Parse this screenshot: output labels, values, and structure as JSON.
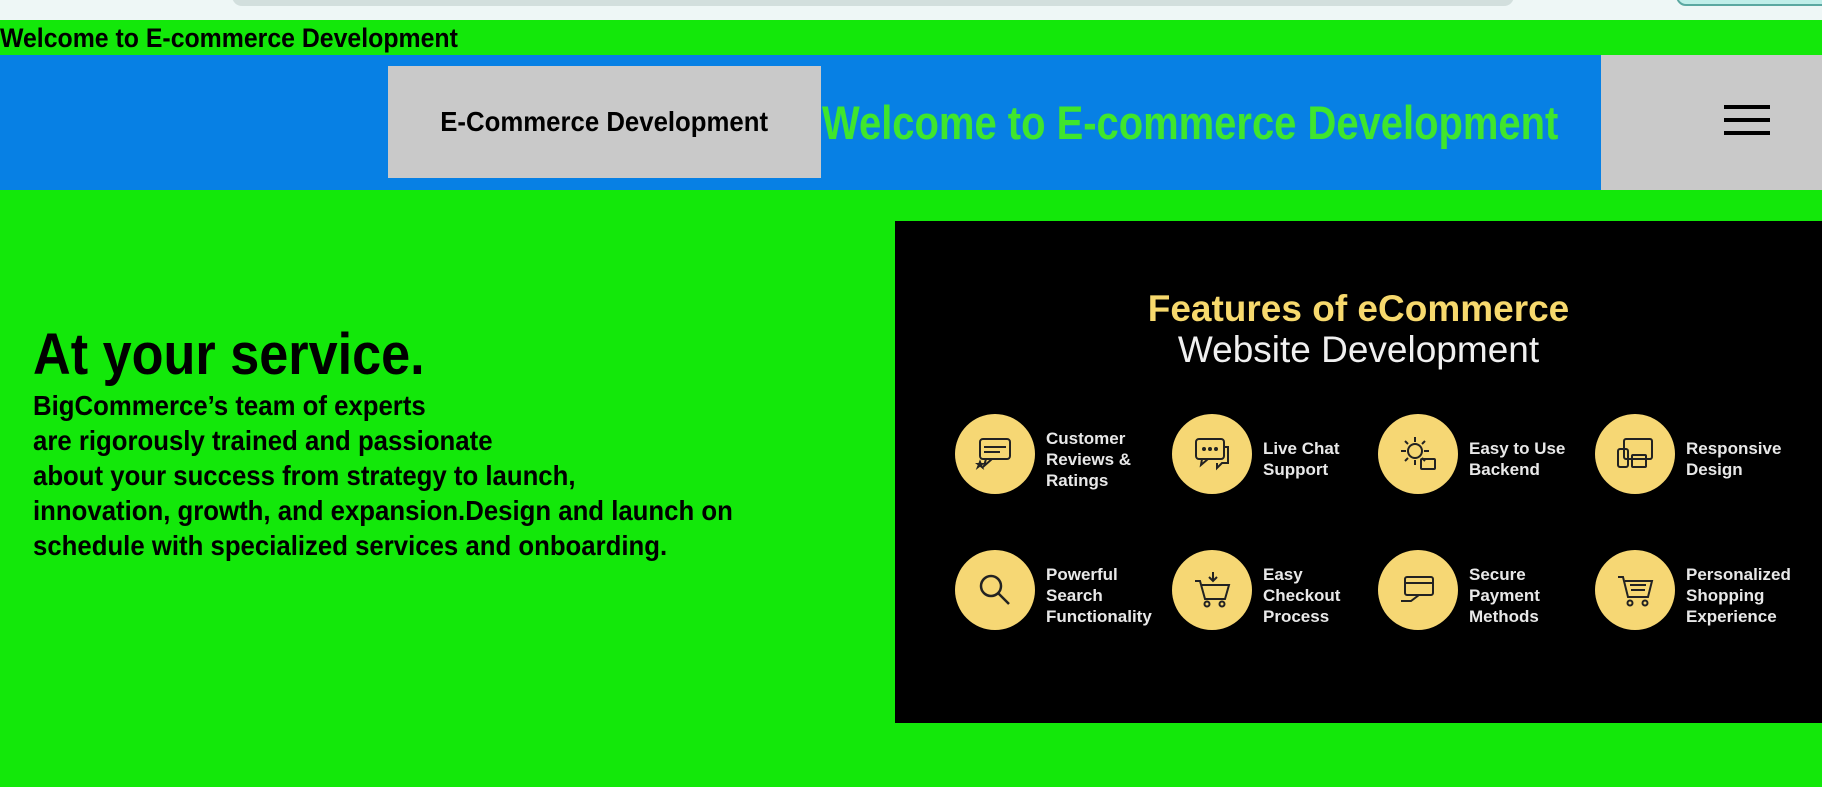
{
  "top_banner": {
    "text": "Welcome to E-commerce Development"
  },
  "navbar": {
    "brand": "E-Commerce Development",
    "welcome": "Welcome to E-commerce Development",
    "menu_icon": "hamburger-menu-icon"
  },
  "hero": {
    "title": "At your service.",
    "lines": [
      "BigCommerce’s team of experts",
      "are rigorously trained and passionate",
      "about your success from strategy to launch,",
      "innovation, growth, and expansion.Design and launch on",
      "schedule with specialized services and onboarding."
    ]
  },
  "feature_image": {
    "title_line1": "Features of eCommerce",
    "title_line2": "Website Development",
    "features": [
      {
        "label": "Customer\nReviews &\nRatings",
        "icon": "reviews-icon"
      },
      {
        "label": "Live Chat\nSupport",
        "icon": "chat-icon"
      },
      {
        "label": "Easy to Use\nBackend",
        "icon": "gear-icon"
      },
      {
        "label": "Responsive\nDesign",
        "icon": "devices-icon"
      },
      {
        "label": "Powerful\nSearch\nFunctionality",
        "icon": "search-icon"
      },
      {
        "label": "Easy\nCheckout\nProcess",
        "icon": "cart-icon"
      },
      {
        "label": "Secure\nPayment\nMethods",
        "icon": "card-icon"
      },
      {
        "label": "Personalized\nShopping\nExperience",
        "icon": "shopping-cart-icon"
      }
    ]
  },
  "colors": {
    "page_background": "#13e80a",
    "navbar_background": "#0780e4",
    "nav_box": "#c9c9c9",
    "nav_welcome_text": "#3fe62d",
    "feature_accent": "#f6d774"
  }
}
